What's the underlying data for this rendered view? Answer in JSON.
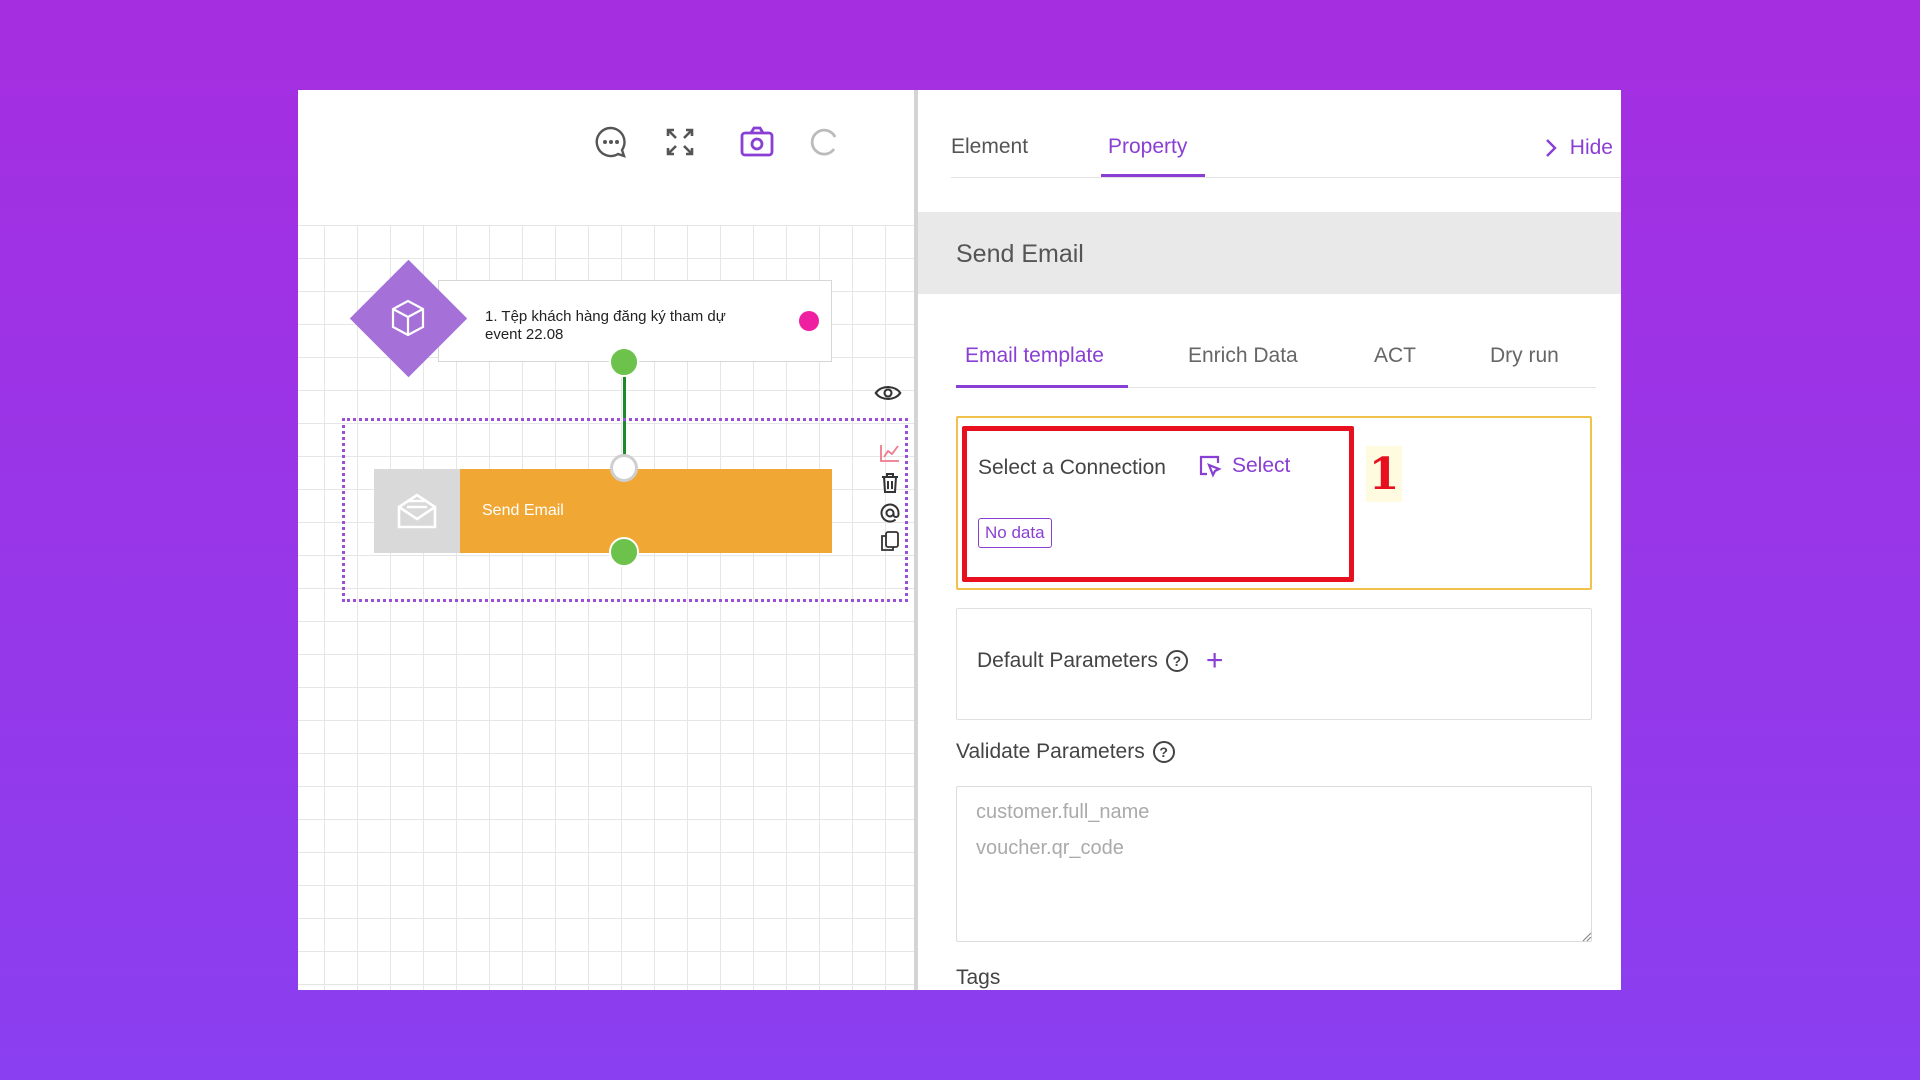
{
  "canvas": {
    "toolbar": {
      "comment_icon": "chat-bubble-icon",
      "fullscreen_icon": "expand-icon",
      "snapshot_icon": "camera-icon",
      "reload_icon": "reload-icon"
    },
    "trigger_node": {
      "icon": "cube-icon",
      "label": "1. Tệp khách hàng đăng ký tham dự event 22.08"
    },
    "action_node": {
      "icon": "envelope-icon",
      "label": "Send Email"
    },
    "node_tools": [
      "eye-icon",
      "chart-icon",
      "trash-icon",
      "at-sign-icon",
      "copy-icon"
    ],
    "colors": {
      "trigger": "#a571d8",
      "action": "#f0a733",
      "port": "#6cc24a",
      "connector": "#1d8a2a",
      "status_dot": "#ee1fa0"
    }
  },
  "panel": {
    "tabs": [
      "Element",
      "Property"
    ],
    "active_tab": "Property",
    "hide_label": "Hide",
    "section_title": "Send Email",
    "sub_tabs": [
      "Email template",
      "Enrich Data",
      "ACT",
      "Dry run"
    ],
    "active_sub_tab": "Email template",
    "connection": {
      "label": "Select a Connection",
      "select_label": "Select",
      "status": "No data",
      "step_marker": "1"
    },
    "default_parameters_label": "Default Parameters",
    "validate_parameters_label": "Validate Parameters",
    "validate_placeholder_lines": [
      "customer.full_name",
      "voucher.qr_code"
    ],
    "tags_label": "Tags",
    "accent_color": "#8a3fd4"
  }
}
